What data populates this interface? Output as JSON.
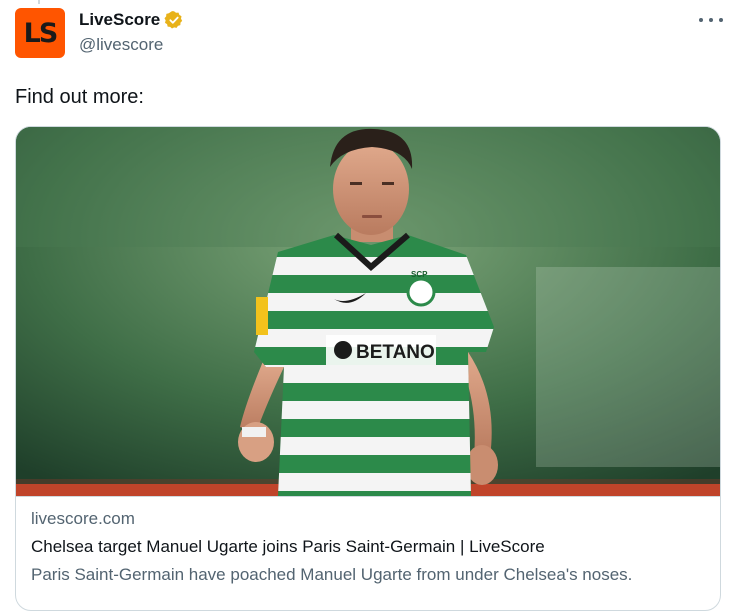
{
  "author": {
    "display_name": "LiveScore",
    "handle": "@livescore",
    "avatar_text": "LS",
    "avatar_color": "#ff5500",
    "verified_badge_color": "#e8b21a"
  },
  "tweet": {
    "text": "Find out more:"
  },
  "card": {
    "domain": "livescore.com",
    "title": "Chelsea target Manuel Ugarte joins Paris Saint-Germain | LiveScore",
    "description": "Paris Saint-Germain have poached Manuel Ugarte from under Chelsea's noses.",
    "image": {
      "subject": "football player in green-white hooped Sporting CP shirt",
      "sponsor_text": "BETANO",
      "crest_text": "SCP"
    }
  },
  "icons": {
    "more": "more-horizontal-icon",
    "verified": "verified-badge-icon"
  }
}
